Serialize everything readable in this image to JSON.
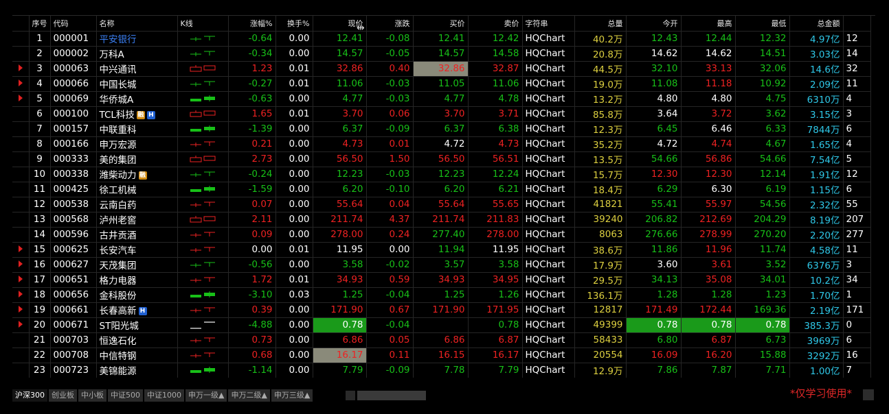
{
  "headers": [
    "",
    "序号",
    "代码",
    "名称",
    "K线",
    "涨幅%",
    "换手%",
    "现价",
    "涨跌",
    "买价",
    "卖价",
    "字符串",
    "总量",
    "今开",
    "最高",
    "最低",
    "总金额",
    ""
  ],
  "rows": [
    {
      "arrow": false,
      "n": "1",
      "code": "000001",
      "name": "平安银行",
      "nameBlue": true,
      "badges": [],
      "k": "g",
      "chg": "-0.64",
      "to": "0.00",
      "px": "12.41",
      "d": "-0.08",
      "bid": "12.41",
      "ask": "12.42",
      "str": "HQChart",
      "vol": "40.2万",
      "open": "12.43",
      "high": "12.44",
      "low": "12.32",
      "amt": "4.97亿",
      "x": "12",
      "c": {
        "chg": "dn",
        "px": "dn",
        "d": "dn",
        "bid": "dn",
        "ask": "dn",
        "open": "dn",
        "high": "dn",
        "low": "dn"
      }
    },
    {
      "arrow": false,
      "n": "2",
      "code": "000002",
      "name": "万科A",
      "badges": [],
      "k": "g",
      "chg": "-0.34",
      "to": "0.00",
      "px": "14.57",
      "d": "-0.05",
      "bid": "14.57",
      "ask": "14.58",
      "str": "HQChart",
      "vol": "20.8万",
      "open": "14.62",
      "high": "14.62",
      "low": "14.51",
      "amt": "3.03亿",
      "x": "14",
      "c": {
        "chg": "dn",
        "px": "dn",
        "d": "dn",
        "bid": "dn",
        "ask": "dn",
        "open": "wt",
        "high": "wt",
        "low": "dn"
      }
    },
    {
      "arrow": true,
      "n": "3",
      "code": "000063",
      "name": "中兴通讯",
      "badges": [],
      "k": "rb",
      "chg": "1.23",
      "to": "0.01",
      "px": "32.86",
      "d": "0.40",
      "bid": "32.86",
      "ask": "32.87",
      "str": "HQChart",
      "vol": "44.5万",
      "open": "32.10",
      "high": "33.13",
      "low": "32.06",
      "amt": "14.6亿",
      "x": "32",
      "c": {
        "chg": "up",
        "px": "up",
        "d": "up",
        "bid": "up",
        "ask": "up",
        "open": "dn",
        "high": "up",
        "low": "dn"
      },
      "hl": {
        "bid": "gray"
      }
    },
    {
      "arrow": true,
      "n": "4",
      "code": "000066",
      "name": "中国长城",
      "badges": [],
      "k": "g",
      "chg": "-0.27",
      "to": "0.01",
      "px": "11.06",
      "d": "-0.03",
      "bid": "11.05",
      "ask": "11.06",
      "str": "HQChart",
      "vol": "19.0万",
      "open": "11.08",
      "high": "11.18",
      "low": "10.92",
      "amt": "2.09亿",
      "x": "11",
      "c": {
        "chg": "dn",
        "px": "dn",
        "d": "dn",
        "bid": "dn",
        "ask": "dn",
        "open": "dn",
        "high": "up",
        "low": "dn"
      }
    },
    {
      "arrow": true,
      "n": "5",
      "code": "000069",
      "name": "华侨城A",
      "badges": [],
      "k": "gs",
      "chg": "-0.63",
      "to": "0.00",
      "px": "4.77",
      "d": "-0.03",
      "bid": "4.77",
      "ask": "4.78",
      "str": "HQChart",
      "vol": "13.2万",
      "open": "4.80",
      "high": "4.80",
      "low": "4.75",
      "amt": "6310万",
      "x": "4",
      "c": {
        "chg": "dn",
        "px": "dn",
        "d": "dn",
        "bid": "dn",
        "ask": "dn",
        "open": "wt",
        "high": "wt",
        "low": "dn"
      }
    },
    {
      "arrow": false,
      "n": "6",
      "code": "000100",
      "name": "TCL科技",
      "badges": [
        "rong",
        "h"
      ],
      "k": "rb",
      "chg": "1.65",
      "to": "0.01",
      "px": "3.70",
      "d": "0.06",
      "bid": "3.70",
      "ask": "3.71",
      "str": "HQChart",
      "vol": "85.8万",
      "open": "3.64",
      "high": "3.72",
      "low": "3.62",
      "amt": "3.15亿",
      "x": "3",
      "c": {
        "chg": "up",
        "px": "up",
        "d": "up",
        "bid": "up",
        "ask": "up",
        "open": "wt",
        "high": "up",
        "low": "dn"
      }
    },
    {
      "arrow": false,
      "n": "7",
      "code": "000157",
      "name": "中联重科",
      "badges": [],
      "k": "gs",
      "chg": "-1.39",
      "to": "0.00",
      "px": "6.37",
      "d": "-0.09",
      "bid": "6.37",
      "ask": "6.38",
      "str": "HQChart",
      "vol": "12.3万",
      "open": "6.45",
      "high": "6.46",
      "low": "6.33",
      "amt": "7844万",
      "x": "6",
      "c": {
        "chg": "dn",
        "px": "dn",
        "d": "dn",
        "bid": "dn",
        "ask": "dn",
        "open": "dn",
        "high": "wt",
        "low": "dn"
      }
    },
    {
      "arrow": false,
      "n": "8",
      "code": "000166",
      "name": "申万宏源",
      "badges": [],
      "k": "r",
      "chg": "0.21",
      "to": "0.00",
      "px": "4.73",
      "d": "0.01",
      "bid": "4.72",
      "ask": "4.73",
      "str": "HQChart",
      "vol": "35.2万",
      "open": "4.72",
      "high": "4.74",
      "low": "4.67",
      "amt": "1.65亿",
      "x": "4",
      "c": {
        "chg": "up",
        "px": "up",
        "d": "up",
        "bid": "wt",
        "ask": "up",
        "open": "wt",
        "high": "up",
        "low": "dn"
      }
    },
    {
      "arrow": false,
      "n": "9",
      "code": "000333",
      "name": "美的集团",
      "badges": [],
      "k": "rb",
      "chg": "2.73",
      "to": "0.00",
      "px": "56.50",
      "d": "1.50",
      "bid": "56.50",
      "ask": "56.51",
      "str": "HQChart",
      "vol": "13.5万",
      "open": "54.66",
      "high": "56.86",
      "low": "54.66",
      "amt": "7.54亿",
      "x": "5",
      "c": {
        "chg": "up",
        "px": "up",
        "d": "up",
        "bid": "up",
        "ask": "up",
        "open": "dn",
        "high": "up",
        "low": "dn"
      }
    },
    {
      "arrow": false,
      "n": "10",
      "code": "000338",
      "name": "潍柴动力",
      "badges": [
        "rong"
      ],
      "k": "g",
      "chg": "-0.24",
      "to": "0.00",
      "px": "12.23",
      "d": "-0.03",
      "bid": "12.23",
      "ask": "12.24",
      "str": "HQChart",
      "vol": "15.7万",
      "open": "12.30",
      "high": "12.30",
      "low": "12.14",
      "amt": "1.91亿",
      "x": "12",
      "c": {
        "chg": "dn",
        "px": "dn",
        "d": "dn",
        "bid": "dn",
        "ask": "dn",
        "open": "up",
        "high": "up",
        "low": "dn"
      }
    },
    {
      "arrow": false,
      "n": "11",
      "code": "000425",
      "name": "徐工机械",
      "badges": [],
      "k": "gs",
      "chg": "-1.59",
      "to": "0.00",
      "px": "6.20",
      "d": "-0.10",
      "bid": "6.20",
      "ask": "6.21",
      "str": "HQChart",
      "vol": "18.4万",
      "open": "6.29",
      "high": "6.30",
      "low": "6.19",
      "amt": "1.15亿",
      "x": "6",
      "c": {
        "chg": "dn",
        "px": "dn",
        "d": "dn",
        "bid": "dn",
        "ask": "dn",
        "open": "dn",
        "high": "wt",
        "low": "dn"
      }
    },
    {
      "arrow": false,
      "n": "12",
      "code": "000538",
      "name": "云南白药",
      "badges": [],
      "k": "r",
      "chg": "0.07",
      "to": "0.00",
      "px": "55.64",
      "d": "0.04",
      "bid": "55.64",
      "ask": "55.65",
      "str": "HQChart",
      "vol": "41821",
      "open": "55.41",
      "high": "55.97",
      "low": "54.56",
      "amt": "2.32亿",
      "x": "55",
      "c": {
        "chg": "up",
        "px": "up",
        "d": "up",
        "bid": "up",
        "ask": "up",
        "open": "dn",
        "high": "up",
        "low": "dn"
      }
    },
    {
      "arrow": false,
      "n": "13",
      "code": "000568",
      "name": "泸州老窖",
      "badges": [],
      "k": "rb",
      "chg": "2.11",
      "to": "0.00",
      "px": "211.74",
      "d": "4.37",
      "bid": "211.74",
      "ask": "211.83",
      "str": "HQChart",
      "vol": "39240",
      "open": "206.82",
      "high": "212.69",
      "low": "204.29",
      "amt": "8.19亿",
      "x": "207",
      "c": {
        "chg": "up",
        "px": "up",
        "d": "up",
        "bid": "up",
        "ask": "up",
        "open": "dn",
        "high": "up",
        "low": "dn"
      }
    },
    {
      "arrow": false,
      "n": "14",
      "code": "000596",
      "name": "古井贡酒",
      "badges": [],
      "k": "r",
      "chg": "0.09",
      "to": "0.00",
      "px": "278.00",
      "d": "0.24",
      "bid": "277.40",
      "ask": "278.00",
      "str": "HQChart",
      "vol": "8063",
      "open": "276.66",
      "high": "278.99",
      "low": "270.20",
      "amt": "2.20亿",
      "x": "277",
      "c": {
        "chg": "up",
        "px": "up",
        "d": "up",
        "bid": "dn",
        "ask": "up",
        "open": "dn",
        "high": "up",
        "low": "dn"
      }
    },
    {
      "arrow": true,
      "n": "15",
      "code": "000625",
      "name": "长安汽车",
      "badges": [],
      "k": "r",
      "chg": "0.00",
      "to": "0.01",
      "px": "11.95",
      "d": "0.00",
      "bid": "11.94",
      "ask": "11.95",
      "str": "HQChart",
      "vol": "38.6万",
      "open": "11.86",
      "high": "11.96",
      "low": "11.74",
      "amt": "4.58亿",
      "x": "11",
      "c": {
        "chg": "wt",
        "px": "wt",
        "d": "wt",
        "bid": "dn",
        "ask": "wt",
        "open": "dn",
        "high": "up",
        "low": "dn"
      }
    },
    {
      "arrow": true,
      "n": "16",
      "code": "000627",
      "name": "天茂集团",
      "badges": [],
      "k": "g",
      "chg": "-0.56",
      "to": "0.00",
      "px": "3.58",
      "d": "-0.02",
      "bid": "3.57",
      "ask": "3.58",
      "str": "HQChart",
      "vol": "17.9万",
      "open": "3.60",
      "high": "3.61",
      "low": "3.52",
      "amt": "6376万",
      "x": "3",
      "c": {
        "chg": "dn",
        "px": "dn",
        "d": "dn",
        "bid": "dn",
        "ask": "dn",
        "open": "wt",
        "high": "up",
        "low": "dn"
      }
    },
    {
      "arrow": true,
      "n": "17",
      "code": "000651",
      "name": "格力电器",
      "badges": [],
      "k": "r",
      "chg": "1.72",
      "to": "0.01",
      "px": "34.93",
      "d": "0.59",
      "bid": "34.93",
      "ask": "34.95",
      "str": "HQChart",
      "vol": "29.5万",
      "open": "34.13",
      "high": "35.08",
      "low": "34.01",
      "amt": "10.2亿",
      "x": "34",
      "c": {
        "chg": "up",
        "px": "up",
        "d": "up",
        "bid": "up",
        "ask": "up",
        "open": "dn",
        "high": "up",
        "low": "dn"
      }
    },
    {
      "arrow": true,
      "n": "18",
      "code": "000656",
      "name": "金科股份",
      "badges": [],
      "k": "gs",
      "chg": "-3.10",
      "to": "0.03",
      "px": "1.25",
      "d": "-0.04",
      "bid": "1.25",
      "ask": "1.26",
      "str": "HQChart",
      "vol": "136.1万",
      "open": "1.28",
      "high": "1.28",
      "low": "1.23",
      "amt": "1.70亿",
      "x": "1",
      "c": {
        "chg": "dn",
        "px": "dn",
        "d": "dn",
        "bid": "dn",
        "ask": "dn",
        "open": "dn",
        "high": "dn",
        "low": "dn"
      }
    },
    {
      "arrow": true,
      "n": "19",
      "code": "000661",
      "name": "长春高新",
      "badges": [
        "h"
      ],
      "k": "r",
      "chg": "0.39",
      "to": "0.00",
      "px": "171.90",
      "d": "0.67",
      "bid": "171.90",
      "ask": "171.95",
      "str": "HQChart",
      "vol": "12817",
      "open": "171.49",
      "high": "172.44",
      "low": "169.36",
      "amt": "2.19亿",
      "x": "171",
      "c": {
        "chg": "up",
        "px": "up",
        "d": "up",
        "bid": "up",
        "ask": "up",
        "open": "up",
        "high": "up",
        "low": "dn"
      }
    },
    {
      "arrow": true,
      "n": "20",
      "code": "000671",
      "name": "ST阳光城",
      "badges": [],
      "k": "w",
      "chg": "-4.88",
      "to": "0.00",
      "px": "0.78",
      "d": "-0.04",
      "bid": "",
      "ask": "0.78",
      "str": "HQChart",
      "vol": "49399",
      "open": "0.78",
      "high": "0.78",
      "low": "0.78",
      "amt": "385.3万",
      "x": "0",
      "c": {
        "chg": "dn",
        "px": "wt",
        "d": "dn",
        "bid": "dn",
        "ask": "dn",
        "open": "wt",
        "high": "wt",
        "low": "wt"
      },
      "hl": {
        "px": "green",
        "open": "green",
        "high": "green",
        "low": "green"
      }
    },
    {
      "arrow": false,
      "n": "21",
      "code": "000703",
      "name": "恒逸石化",
      "badges": [],
      "k": "r",
      "chg": "0.73",
      "to": "0.00",
      "px": "6.86",
      "d": "0.05",
      "bid": "6.86",
      "ask": "6.87",
      "str": "HQChart",
      "vol": "58433",
      "open": "6.80",
      "high": "6.87",
      "low": "6.73",
      "amt": "3969万",
      "x": "6",
      "c": {
        "chg": "up",
        "px": "up",
        "d": "up",
        "bid": "up",
        "ask": "up",
        "open": "dn",
        "high": "up",
        "low": "dn"
      }
    },
    {
      "arrow": false,
      "n": "22",
      "code": "000708",
      "name": "中信特钢",
      "badges": [],
      "k": "r",
      "chg": "0.68",
      "to": "0.00",
      "px": "16.17",
      "d": "0.11",
      "bid": "16.15",
      "ask": "16.17",
      "str": "HQChart",
      "vol": "20554",
      "open": "16.09",
      "high": "16.20",
      "low": "15.88",
      "amt": "3292万",
      "x": "16",
      "c": {
        "chg": "up",
        "px": "up",
        "d": "up",
        "bid": "up",
        "ask": "up",
        "open": "up",
        "high": "up",
        "low": "dn"
      },
      "hl": {
        "px": "gray"
      }
    },
    {
      "arrow": false,
      "n": "23",
      "code": "000723",
      "name": "美锦能源",
      "badges": [],
      "k": "gs",
      "chg": "-1.14",
      "to": "0.00",
      "px": "7.79",
      "d": "-0.09",
      "bid": "7.78",
      "ask": "7.79",
      "str": "HQChart",
      "vol": "12.9万",
      "open": "7.86",
      "high": "7.87",
      "low": "7.71",
      "amt": "1.00亿",
      "x": "7",
      "c": {
        "chg": "dn",
        "px": "dn",
        "d": "dn",
        "bid": "dn",
        "ask": "dn",
        "open": "dn",
        "high": "dn",
        "low": "dn"
      }
    }
  ],
  "tabs": [
    "沪深300",
    "创业板",
    "中小板",
    "中证500",
    "中证1000",
    "申万一级▲",
    "申万二级▲",
    "申万三级▲"
  ],
  "badge_labels": {
    "rong": "融",
    "h": "H"
  },
  "note": "*仅学习使用*",
  "colors": {
    "up": "#ee2222",
    "down": "#18c018",
    "neutral": "#ffffff",
    "volume": "#ddd040",
    "amount": "#2fc8e8",
    "name_link": "#3a7ef0"
  }
}
